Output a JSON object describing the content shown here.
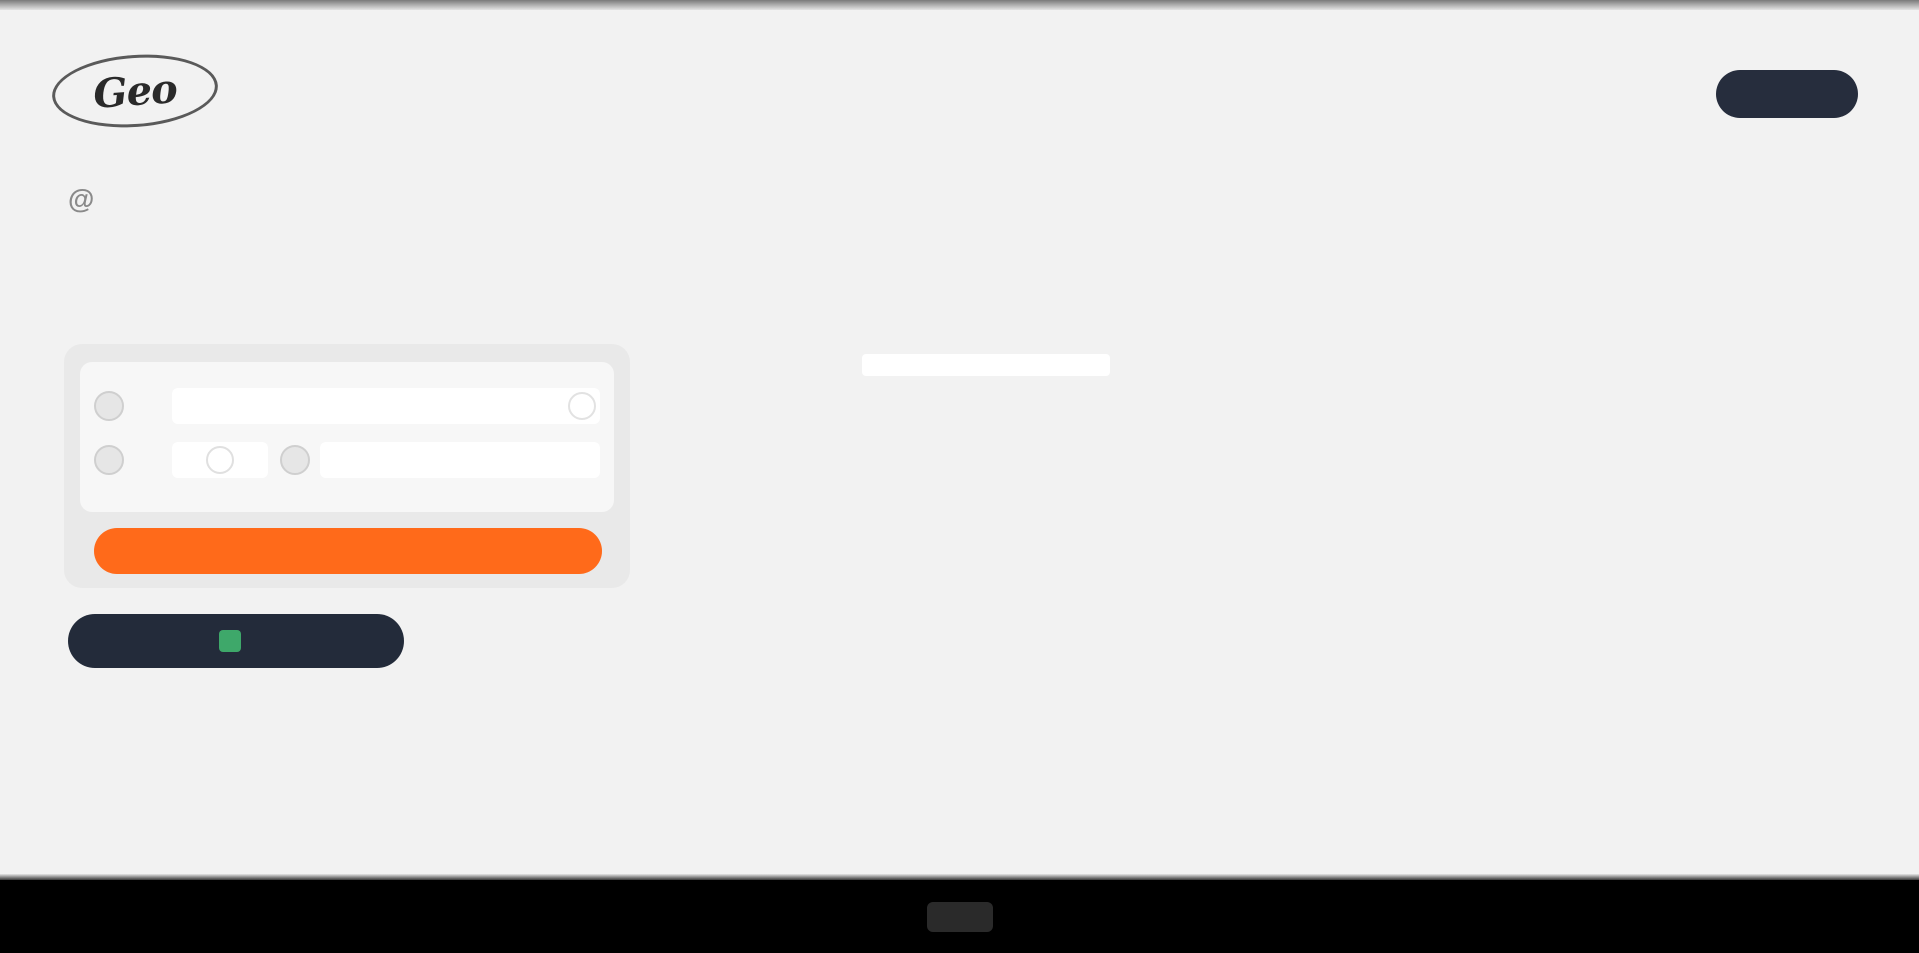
{
  "header": {
    "logo_text": "Geo",
    "logo_sub": "",
    "action_button_label": ""
  },
  "page": {
    "title_prefix": "",
    "title_at": "@",
    "title_suffix": "",
    "intro": ""
  },
  "card": {
    "label": "",
    "row1_text": "",
    "row2_text": "",
    "row2_field_text": "",
    "primary_button_label": ""
  },
  "side": {
    "label": ""
  },
  "dark_button": {
    "label": ""
  },
  "bottom": {
    "label": ""
  },
  "colors": {
    "accent": "#ff6a1a",
    "dark": "#232b3a",
    "background": "#f2f2f2"
  }
}
